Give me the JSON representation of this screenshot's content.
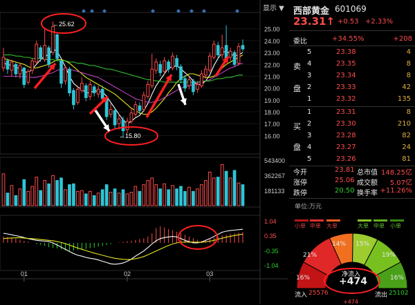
{
  "toolbar": {
    "show_label": "显示 ▼"
  },
  "stock": {
    "name": "西部黄金",
    "code": "601069",
    "price": "23.31↑",
    "change": "+0.53",
    "change_pct": "+2.33%"
  },
  "weibi": {
    "label": "委比",
    "pct": "+34.55%",
    "diff": "+208"
  },
  "sell_label": [
    "卖",
    "盘"
  ],
  "buy_label": [
    "买",
    "盘"
  ],
  "sell_orders": [
    {
      "level": "5",
      "price": "23.38",
      "vol": "4"
    },
    {
      "level": "4",
      "price": "23.35",
      "vol": "8"
    },
    {
      "level": "3",
      "price": "23.34",
      "vol": "8"
    },
    {
      "level": "2",
      "price": "23.33",
      "vol": "42"
    },
    {
      "level": "1",
      "price": "23.32",
      "vol": "135"
    }
  ],
  "buy_orders": [
    {
      "level": "1",
      "price": "23.31",
      "vol": "8"
    },
    {
      "level": "2",
      "price": "23.30",
      "vol": "210"
    },
    {
      "level": "3",
      "price": "23.28",
      "vol": "82"
    },
    {
      "level": "4",
      "price": "23.27",
      "vol": "24"
    },
    {
      "level": "5",
      "price": "23.26",
      "vol": "81"
    }
  ],
  "stats": [
    {
      "l1": "今开",
      "v1": "23.81",
      "l2": "总市值",
      "v2": "148.25亿"
    },
    {
      "l1": "涨停",
      "v1": "25.06",
      "l2": "成交额",
      "v2": "5.07亿"
    },
    {
      "l1": "跌停",
      "v1": "20.50",
      "l2": "换手率",
      "v2": "+11.26%"
    }
  ],
  "unit_label": "单位:万元",
  "flow_legend": [
    "小单",
    "中单",
    "大单",
    "大单",
    "中单",
    "小单"
  ],
  "gauge": {
    "segments": [
      "16%",
      "21%",
      "14%",
      "15%",
      "19%",
      "16%"
    ],
    "net_label": "净流入",
    "net_value": "+474",
    "inflow_label": "流入",
    "inflow_value": "25576",
    "outflow_label": "流出",
    "outflow_value": "25102",
    "bottom_value": "+474"
  },
  "colors": {
    "up": "#ff4c4c",
    "down": "#2ec5d6",
    "ma5": "#ffffff",
    "ma10": "#e8e820",
    "ma20": "#c040c0",
    "ma60": "#30c030",
    "annotation": "#ff2020"
  },
  "annotations": {
    "high": "25.62",
    "low": "15.80"
  },
  "chart_data": [
    {
      "type": "candlestick",
      "price_axis_ticks": [
        "25.00",
        "24.00",
        "23.00",
        "22.00",
        "21.00",
        "20.00",
        "19.00",
        "18.00",
        "17.00",
        "16.00"
      ],
      "ylim": [
        15.5,
        25.8
      ],
      "x_tick_labels": [
        "01",
        "02",
        "03"
      ],
      "x_tick_index": [
        5,
        30,
        50
      ],
      "candles": [
        {
          "o": 21.7,
          "c": 22.6,
          "h": 23.4,
          "l": 21.4
        },
        {
          "o": 22.3,
          "c": 21.6,
          "h": 22.5,
          "l": 21.2
        },
        {
          "o": 21.5,
          "c": 22.2,
          "h": 22.4,
          "l": 21.0
        },
        {
          "o": 22.0,
          "c": 21.2,
          "h": 22.2,
          "l": 20.9
        },
        {
          "o": 21.2,
          "c": 21.9,
          "h": 22.1,
          "l": 20.8
        },
        {
          "o": 21.7,
          "c": 20.3,
          "h": 21.8,
          "l": 20.0
        },
        {
          "o": 20.5,
          "c": 21.4,
          "h": 21.6,
          "l": 20.3
        },
        {
          "o": 21.5,
          "c": 22.3,
          "h": 22.5,
          "l": 21.2
        },
        {
          "o": 22.2,
          "c": 23.7,
          "h": 24.0,
          "l": 22.0
        },
        {
          "o": 23.4,
          "c": 22.5,
          "h": 23.6,
          "l": 22.2
        },
        {
          "o": 22.4,
          "c": 23.6,
          "h": 25.1,
          "l": 22.2
        },
        {
          "o": 23.4,
          "c": 22.0,
          "h": 23.6,
          "l": 21.7
        },
        {
          "o": 23.0,
          "c": 25.2,
          "h": 25.62,
          "l": 22.8
        },
        {
          "o": 24.5,
          "c": 22.5,
          "h": 24.6,
          "l": 22.3
        },
        {
          "o": 22.3,
          "c": 20.4,
          "h": 22.4,
          "l": 20.0
        },
        {
          "o": 20.6,
          "c": 21.7,
          "h": 21.9,
          "l": 20.3
        },
        {
          "o": 21.6,
          "c": 19.6,
          "h": 21.8,
          "l": 19.3
        },
        {
          "o": 19.8,
          "c": 18.6,
          "h": 20.0,
          "l": 18.2
        },
        {
          "o": 18.8,
          "c": 19.9,
          "h": 20.2,
          "l": 18.6
        },
        {
          "o": 19.8,
          "c": 20.4,
          "h": 20.9,
          "l": 19.6
        },
        {
          "o": 20.2,
          "c": 19.2,
          "h": 20.4,
          "l": 18.9
        },
        {
          "o": 19.3,
          "c": 20.3,
          "h": 20.6,
          "l": 19.0
        },
        {
          "o": 20.1,
          "c": 19.6,
          "h": 20.3,
          "l": 19.3
        },
        {
          "o": 19.5,
          "c": 19.9,
          "h": 20.2,
          "l": 19.2
        },
        {
          "o": 19.9,
          "c": 19.1,
          "h": 20.2,
          "l": 18.8
        },
        {
          "o": 19.2,
          "c": 17.6,
          "h": 19.4,
          "l": 17.3
        },
        {
          "o": 17.8,
          "c": 18.2,
          "h": 18.7,
          "l": 17.5
        },
        {
          "o": 18.1,
          "c": 16.9,
          "h": 18.3,
          "l": 16.6
        },
        {
          "o": 17.0,
          "c": 17.4,
          "h": 17.8,
          "l": 16.5
        },
        {
          "o": 17.3,
          "c": 16.4,
          "h": 17.6,
          "l": 15.8
        },
        {
          "o": 16.5,
          "c": 17.2,
          "h": 17.5,
          "l": 16.2
        },
        {
          "o": 17.2,
          "c": 17.9,
          "h": 18.3,
          "l": 17.0
        },
        {
          "o": 17.8,
          "c": 18.6,
          "h": 18.9,
          "l": 17.6
        },
        {
          "o": 18.5,
          "c": 18.1,
          "h": 18.8,
          "l": 17.8
        },
        {
          "o": 18.2,
          "c": 19.4,
          "h": 19.7,
          "l": 18.0
        },
        {
          "o": 19.3,
          "c": 20.3,
          "h": 20.6,
          "l": 19.1
        },
        {
          "o": 20.2,
          "c": 21.6,
          "h": 22.9,
          "l": 20.0
        },
        {
          "o": 21.5,
          "c": 22.2,
          "h": 22.5,
          "l": 21.2
        },
        {
          "o": 22.0,
          "c": 21.3,
          "h": 22.3,
          "l": 21.0
        },
        {
          "o": 21.4,
          "c": 22.3,
          "h": 22.6,
          "l": 21.1
        },
        {
          "o": 22.2,
          "c": 21.6,
          "h": 22.4,
          "l": 21.3
        },
        {
          "o": 21.7,
          "c": 22.7,
          "h": 23.0,
          "l": 21.5
        },
        {
          "o": 22.5,
          "c": 21.8,
          "h": 22.8,
          "l": 21.5
        },
        {
          "o": 21.8,
          "c": 20.7,
          "h": 22.0,
          "l": 20.4
        },
        {
          "o": 20.8,
          "c": 20.0,
          "h": 21.1,
          "l": 19.7
        },
        {
          "o": 20.2,
          "c": 20.7,
          "h": 21.0,
          "l": 19.9
        },
        {
          "o": 20.6,
          "c": 19.7,
          "h": 20.8,
          "l": 19.4
        },
        {
          "o": 19.9,
          "c": 20.3,
          "h": 20.6,
          "l": 19.6
        },
        {
          "o": 20.2,
          "c": 21.2,
          "h": 21.5,
          "l": 20.0
        },
        {
          "o": 21.1,
          "c": 21.6,
          "h": 21.9,
          "l": 20.8
        },
        {
          "o": 21.5,
          "c": 22.7,
          "h": 23.0,
          "l": 21.3
        },
        {
          "o": 22.6,
          "c": 23.7,
          "h": 24.0,
          "l": 22.4
        },
        {
          "o": 23.6,
          "c": 22.8,
          "h": 23.9,
          "l": 22.4
        },
        {
          "o": 22.8,
          "c": 23.4,
          "h": 24.5,
          "l": 22.5
        },
        {
          "o": 23.6,
          "c": 22.4,
          "h": 25.3,
          "l": 22.2
        },
        {
          "o": 22.6,
          "c": 23.1,
          "h": 23.4,
          "l": 22.3
        },
        {
          "o": 23.0,
          "c": 22.0,
          "h": 23.2,
          "l": 21.8
        },
        {
          "o": 22.1,
          "c": 23.5,
          "h": 23.8,
          "l": 21.9
        },
        {
          "o": 23.6,
          "c": 23.3,
          "h": 24.1,
          "l": 23.1
        }
      ],
      "ma_series": [
        {
          "color": "#ffffff",
          "values": [
            22.1,
            22.0,
            21.9,
            21.8,
            21.6,
            21.4,
            21.3,
            21.6,
            22.0,
            22.4,
            22.7,
            22.8,
            23.3,
            23.1,
            22.5,
            21.8,
            21.0,
            20.4,
            20.1,
            19.9,
            19.6,
            19.6,
            19.8,
            19.7,
            19.7,
            19.3,
            18.8,
            18.3,
            17.8,
            17.3,
            17.0,
            17.2,
            17.5,
            17.7,
            18.1,
            18.7,
            19.5,
            20.2,
            20.7,
            21.2,
            21.7,
            21.8,
            21.9,
            21.6,
            21.3,
            21.0,
            20.6,
            20.3,
            20.3,
            20.6,
            21.1,
            21.9,
            22.5,
            23.0,
            23.1,
            22.9,
            22.7,
            22.8,
            23.0
          ]
        },
        {
          "color": "#e8e820",
          "values": [
            22.5,
            22.4,
            22.3,
            22.2,
            22.1,
            22.0,
            21.8,
            21.7,
            21.7,
            21.8,
            21.9,
            22.0,
            22.2,
            22.4,
            22.4,
            22.3,
            22.1,
            21.8,
            21.5,
            21.2,
            20.9,
            20.7,
            20.5,
            20.3,
            20.1,
            19.9,
            19.7,
            19.5,
            19.2,
            18.9,
            18.6,
            18.3,
            18.1,
            17.9,
            17.8,
            17.8,
            18.0,
            18.3,
            18.7,
            19.1,
            19.6,
            20.0,
            20.5,
            20.8,
            21.0,
            21.2,
            21.2,
            21.1,
            21.0,
            20.9,
            20.9,
            21.0,
            21.3,
            21.7,
            22.0,
            22.2,
            22.4,
            22.6,
            22.8
          ]
        },
        {
          "color": "#c040c0",
          "values": [
            21.0,
            21.0,
            21.0,
            21.0,
            21.0,
            21.0,
            20.9,
            20.9,
            20.9,
            21.0,
            21.1,
            21.2,
            21.3,
            21.5,
            21.6,
            21.6,
            21.6,
            21.5,
            21.4,
            21.3,
            21.2,
            21.1,
            21.0,
            20.9,
            20.7,
            20.5,
            20.3,
            20.1,
            19.9,
            19.7,
            19.5,
            19.3,
            19.1,
            19.0,
            18.9,
            18.8,
            18.8,
            18.9,
            19.0,
            19.2,
            19.4,
            19.6,
            19.8,
            20.0,
            20.1,
            20.2,
            20.3,
            20.4,
            20.5,
            20.6,
            20.7,
            20.9,
            21.1,
            21.3,
            21.5,
            21.7,
            21.8,
            22.0,
            22.1
          ]
        },
        {
          "color": "#30c030",
          "values": [
            22.8,
            22.8,
            22.8,
            22.7,
            22.7,
            22.6,
            22.6,
            22.5,
            22.5,
            22.5,
            22.4,
            22.4,
            22.4,
            22.3,
            22.3,
            22.3,
            22.2,
            22.2,
            22.1,
            22.1,
            22.0,
            21.9,
            21.9,
            21.8,
            21.7,
            21.6,
            21.6,
            21.5,
            21.4,
            21.3,
            21.2,
            21.1,
            21.0,
            20.9,
            20.8,
            20.7,
            20.7,
            20.6,
            20.6,
            20.5,
            20.5,
            20.5,
            20.5,
            20.5,
            20.5,
            20.5,
            20.5,
            20.5,
            20.6,
            20.6,
            20.6,
            20.7,
            20.8,
            20.8,
            20.9,
            20.9,
            21.0,
            21.1,
            21.1
          ]
        }
      ]
    },
    {
      "type": "bar",
      "name": "volume",
      "axis_ticks": [
        "543400",
        "362267",
        "181133"
      ],
      "ylim": [
        0,
        543400
      ],
      "values": [
        380000,
        150000,
        240000,
        120000,
        200000,
        310000,
        170000,
        230000,
        340000,
        180000,
        300000,
        260000,
        360000,
        300000,
        330000,
        190000,
        250000,
        260000,
        170000,
        180000,
        140000,
        170000,
        120000,
        150000,
        190000,
        250000,
        160000,
        200000,
        150000,
        190000,
        140000,
        160000,
        230000,
        170000,
        250000,
        300000,
        330000,
        250000,
        200000,
        260000,
        190000,
        240000,
        200000,
        230000,
        170000,
        220000,
        170000,
        200000,
        250000,
        300000,
        400000,
        330000,
        340000,
        490000,
        410000,
        330000,
        420000,
        270000,
        250000
      ]
    },
    {
      "type": "bar",
      "name": "macd",
      "axis_ticks": [
        "1.04",
        "0.35",
        "-0.35",
        "-1.04"
      ],
      "ylim": [
        -1.1,
        1.1
      ],
      "values": [
        0.3,
        0.28,
        0.25,
        0.2,
        0.15,
        0.1,
        0.05,
        0.0,
        -0.05,
        -0.1,
        -0.15,
        -0.2,
        -0.24,
        -0.26,
        -0.3,
        -0.35,
        -0.38,
        -0.36,
        -0.33,
        -0.3,
        -0.28,
        -0.25,
        -0.22,
        -0.18,
        -0.15,
        -0.1,
        -0.05,
        0.0,
        0.02,
        0.05,
        0.08,
        0.1,
        0.14,
        0.18,
        0.22,
        0.3,
        0.45,
        0.7,
        0.78,
        0.72,
        0.65,
        0.6,
        0.52,
        0.45,
        0.38,
        0.3,
        0.22,
        0.15,
        0.1,
        0.12,
        0.18,
        0.25,
        0.3,
        0.35,
        0.38,
        0.42,
        0.45,
        0.48,
        0.5
      ],
      "dif": [
        0.45,
        0.42,
        0.38,
        0.34,
        0.3,
        0.25,
        0.2,
        0.16,
        0.12,
        0.1,
        0.08,
        0.06,
        0.0,
        -0.1,
        -0.2,
        -0.3,
        -0.4,
        -0.5,
        -0.58,
        -0.62,
        -0.68,
        -0.72,
        -0.75,
        -0.8,
        -0.86,
        -0.92,
        -0.98,
        -1.0,
        -0.98,
        -0.94,
        -0.86,
        -0.76,
        -0.62,
        -0.5,
        -0.38,
        -0.22,
        -0.05,
        0.1,
        0.2,
        0.25,
        0.28,
        0.3,
        0.28,
        0.2,
        0.12,
        0.06,
        0.0,
        0.0,
        0.04,
        0.12,
        0.2,
        0.3,
        0.4,
        0.5,
        0.55,
        0.58,
        0.6,
        0.62,
        0.64
      ],
      "dea": [
        0.2,
        0.22,
        0.23,
        0.24,
        0.24,
        0.23,
        0.21,
        0.2,
        0.18,
        0.16,
        0.14,
        0.12,
        0.1,
        0.06,
        0.02,
        -0.04,
        -0.1,
        -0.17,
        -0.24,
        -0.3,
        -0.36,
        -0.42,
        -0.48,
        -0.53,
        -0.58,
        -0.63,
        -0.68,
        -0.72,
        -0.75,
        -0.77,
        -0.78,
        -0.77,
        -0.74,
        -0.7,
        -0.64,
        -0.56,
        -0.47,
        -0.38,
        -0.29,
        -0.2,
        -0.12,
        -0.05,
        0.0,
        0.03,
        0.04,
        0.04,
        0.04,
        0.03,
        0.03,
        0.05,
        0.08,
        0.12,
        0.17,
        0.22,
        0.27,
        0.31,
        0.35,
        0.38,
        0.41
      ]
    }
  ]
}
